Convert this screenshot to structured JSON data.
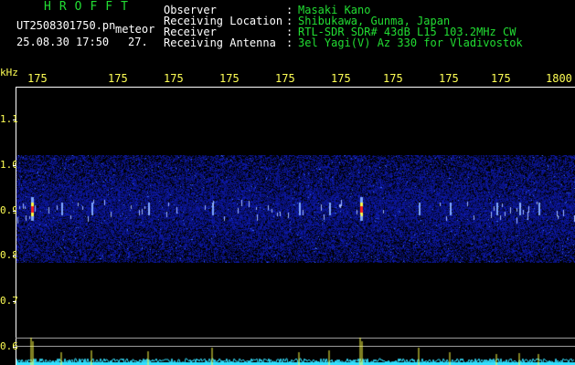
{
  "brand": "HROFFT",
  "file": {
    "name": "UT2508301750.pn",
    "label": "meteor",
    "datetime": "25.08.30 17:50",
    "count": "27."
  },
  "info": {
    "labels": [
      "Observer",
      "Receiving Location",
      "Receiver",
      "Receiving Antenna"
    ],
    "separator": ":",
    "values": [
      "Masaki Kano",
      "Shibukawa, Gunma, Japan",
      "RTL-SDR SDR# 43dB L15 103.2MHz CW",
      "3el Yagi(V) Az 330 for Vladivostok"
    ]
  },
  "axis": {
    "unit": "kHz",
    "y_labels": [
      "1.1",
      "1.0",
      "0.9",
      "0.8",
      "0.7",
      "0.6"
    ],
    "x_labels": [
      "175",
      "175",
      "175",
      "175",
      "175",
      "175",
      "175",
      "175",
      "175",
      "1800"
    ]
  },
  "colors": {
    "header_green": "#22dd33",
    "header_white": "#ffffff",
    "axis_yellow": "#ffff55",
    "spectrum_bg": "#061266",
    "power_cyan": "#33e0ff",
    "signal_yellow": "#ffff44",
    "signal_red": "#ff2020"
  },
  "spectrogram": {
    "freq_band_khz": [
      0.8,
      1.0
    ],
    "signal_freq_khz": 0.92,
    "strong_events_fraction": [
      0.027,
      0.615
    ],
    "medium_events_fraction": [
      0.08,
      0.135,
      0.235,
      0.35,
      0.505,
      0.56,
      0.72,
      0.775,
      0.86,
      0.9,
      0.935
    ]
  }
}
